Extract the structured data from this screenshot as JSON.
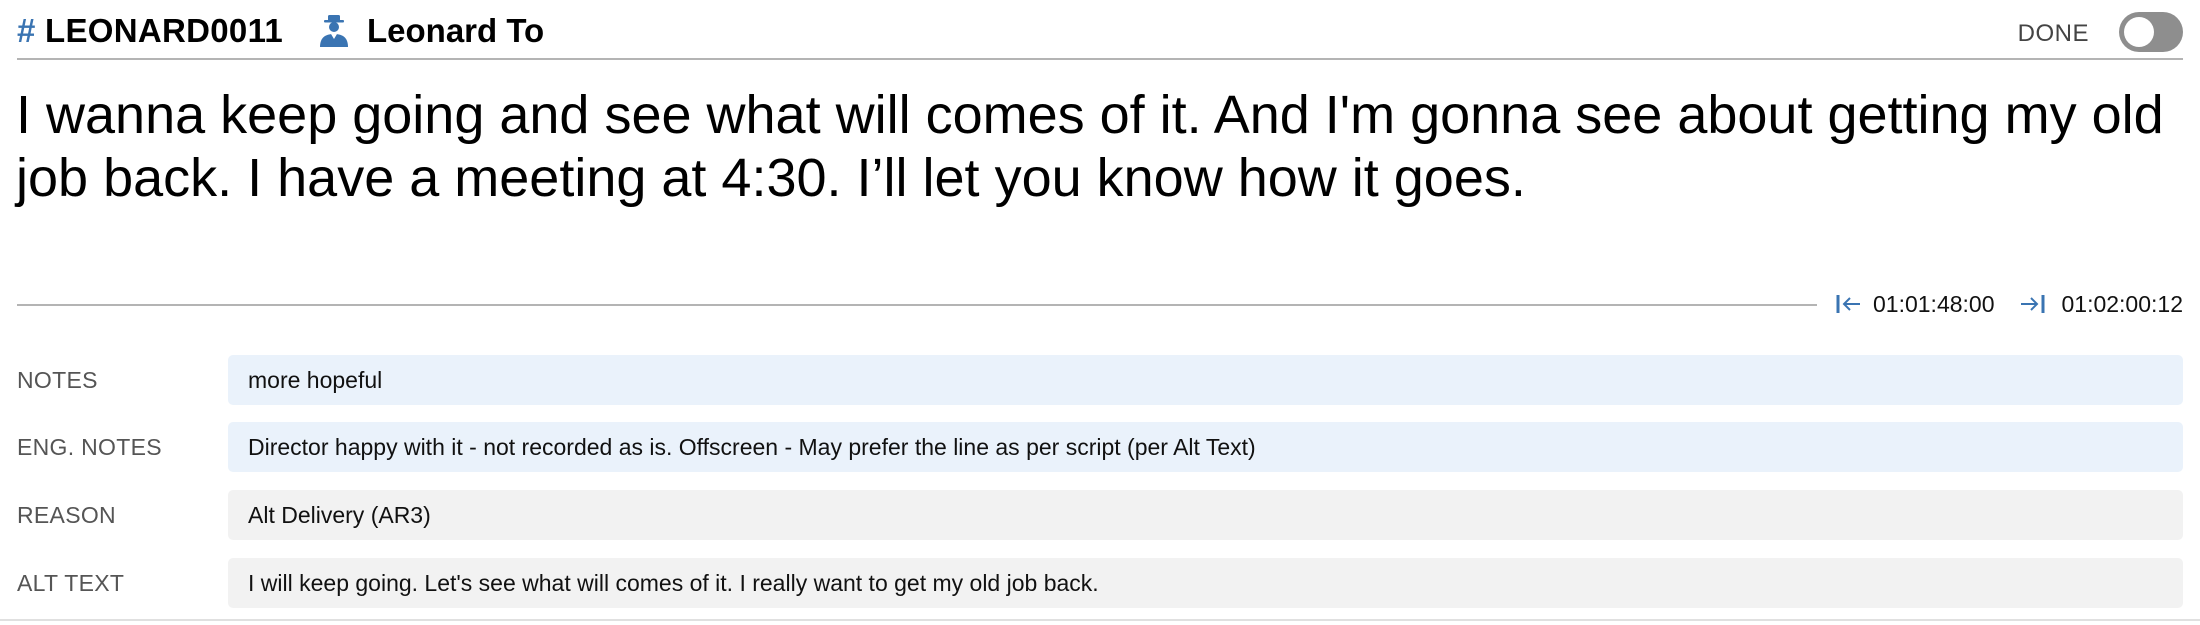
{
  "header": {
    "hash_symbol": "#",
    "character_id": "LEONARD0011",
    "character_name": "Leonard To",
    "done_label": "DONE",
    "done_toggle_on": false
  },
  "dialogue": "I wanna keep going and see what will comes of it. And I'm gonna see about getting my old job back. I have a meeting at 4:30. I’ll let you know how it goes.",
  "timecode": {
    "in": "01:01:48:00",
    "out": "01:02:00:12"
  },
  "fields": [
    {
      "label": "NOTES",
      "value": "more hopeful"
    },
    {
      "label": "ENG. NOTES",
      "value": "Director happy with it - not recorded as is. Offscreen - May prefer the line as per script (per Alt Text)"
    },
    {
      "label": "REASON",
      "value": "Alt Delivery (AR3)"
    },
    {
      "label": "ALT TEXT",
      "value": "I will keep going. Let's see what will comes of it. I really want to get my old job back."
    }
  ],
  "colors": {
    "accent": "#3a74b2",
    "editable_field_bg": "#eaf2fb",
    "readonly_field_bg": "#f2f2f2",
    "toggle_off": "#8e8e8e"
  },
  "icons": {
    "character": "person-icon",
    "timecode_in": "timecode-in-icon",
    "timecode_out": "timecode-out-icon"
  }
}
